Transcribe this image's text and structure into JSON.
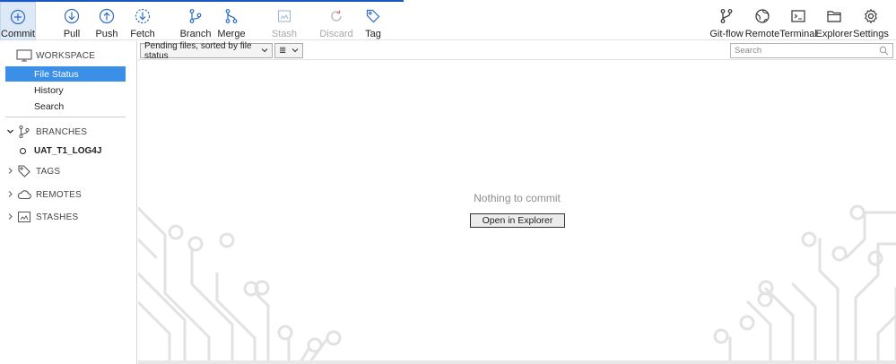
{
  "toolbar": {
    "commit": "Commit",
    "pull": "Pull",
    "push": "Push",
    "fetch": "Fetch",
    "branch": "Branch",
    "merge": "Merge",
    "stash": "Stash",
    "discard": "Discard",
    "tag": "Tag",
    "gitflow": "Git-flow",
    "remote": "Remote",
    "terminal": "Terminal",
    "explorer": "Explorer",
    "settings": "Settings"
  },
  "sidebar": {
    "workspace": "WORKSPACE",
    "items": [
      "File Status",
      "History",
      "Search"
    ],
    "branches": "BRANCHES",
    "branch_list": [
      "UAT_T1_LOG4J"
    ],
    "tags": "TAGS",
    "remotes": "REMOTES",
    "stashes": "STASHES"
  },
  "filter": {
    "sort_label": "Pending files, sorted by file status",
    "view_label": "≣"
  },
  "search": {
    "placeholder": "Search"
  },
  "main": {
    "empty_message": "Nothing to commit",
    "open_button": "Open in Explorer"
  },
  "colors": {
    "accent": "#1a56c4",
    "selection": "#3b8fe6",
    "icon_blue": "#2b6cc4"
  }
}
